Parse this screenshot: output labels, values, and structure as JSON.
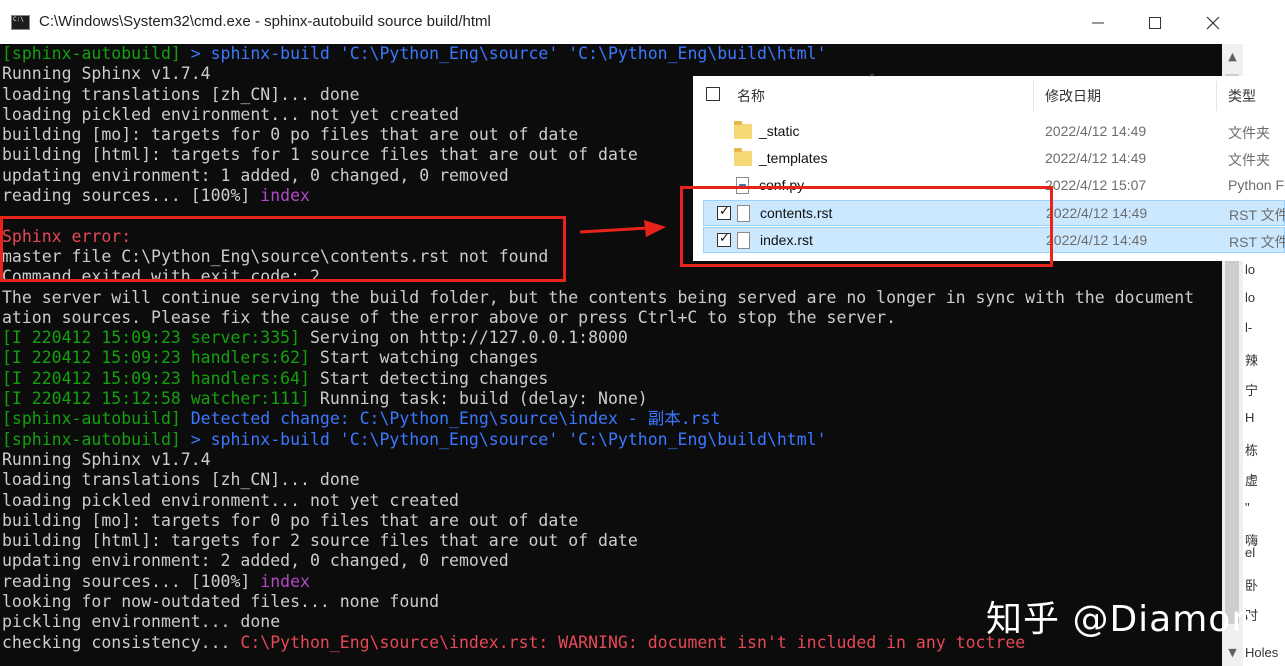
{
  "window": {
    "title": "C:\\Windows\\System32\\cmd.exe - sphinx-autobuild  source build/html",
    "icon": "cmd-icon"
  },
  "console": {
    "lines": [
      [
        {
          "t": "[sphinx-autobuild] ",
          "c": "green"
        },
        {
          "t": "> sphinx-build 'C:\\Python_Eng\\source' 'C:\\Python_Eng\\build\\html'",
          "c": "blue"
        }
      ],
      [
        {
          "t": "Running Sphinx v1.7.4",
          "c": "default"
        }
      ],
      [
        {
          "t": "loading translations [zh_CN]... done",
          "c": "default"
        }
      ],
      [
        {
          "t": "loading pickled environment... not yet created",
          "c": "default"
        }
      ],
      [
        {
          "t": "building [mo]: targets for 0 po files that are out of date",
          "c": "default"
        }
      ],
      [
        {
          "t": "building [html]: targets for 1 source files that are out of date",
          "c": "default"
        }
      ],
      [
        {
          "t": "updating environment: 1 added, 0 changed, 0 removed",
          "c": "default"
        }
      ],
      [
        {
          "t": "reading sources... [100%] ",
          "c": "default"
        },
        {
          "t": "index",
          "c": "purple"
        }
      ],
      [
        {
          "t": "",
          "c": "default"
        }
      ],
      [
        {
          "t": "Sphinx error:",
          "c": "red"
        }
      ],
      [
        {
          "t": "master file C:\\Python_Eng\\source\\contents.rst not found",
          "c": "default"
        }
      ],
      [
        {
          "t": "Command exited with exit code: 2",
          "c": "default"
        }
      ],
      [
        {
          "t": "The server will continue serving the build folder, but the contents being served are no longer in sync with the document",
          "c": "default"
        }
      ],
      [
        {
          "t": "ation sources. Please fix the cause of the error above or press Ctrl+C to stop the server.",
          "c": "default"
        }
      ],
      [
        {
          "t": "[I 220412 15:09:23 server:335] ",
          "c": "green"
        },
        {
          "t": "Serving on http://127.0.0.1:8000",
          "c": "default"
        }
      ],
      [
        {
          "t": "[I 220412 15:09:23 handlers:62] ",
          "c": "green"
        },
        {
          "t": "Start watching changes",
          "c": "default"
        }
      ],
      [
        {
          "t": "[I 220412 15:09:23 handlers:64] ",
          "c": "green"
        },
        {
          "t": "Start detecting changes",
          "c": "default"
        }
      ],
      [
        {
          "t": "[I 220412 15:12:58 watcher:111] ",
          "c": "green"
        },
        {
          "t": "Running task: build (delay: None)",
          "c": "default"
        }
      ],
      [
        {
          "t": "[sphinx-autobuild] ",
          "c": "green"
        },
        {
          "t": "Detected change: C:\\Python_Eng\\source\\index - 副本.rst",
          "c": "blue"
        }
      ],
      [
        {
          "t": "[sphinx-autobuild] ",
          "c": "green"
        },
        {
          "t": "> sphinx-build 'C:\\Python_Eng\\source' 'C:\\Python_Eng\\build\\html'",
          "c": "blue"
        }
      ],
      [
        {
          "t": "Running Sphinx v1.7.4",
          "c": "default"
        }
      ],
      [
        {
          "t": "loading translations [zh_CN]... done",
          "c": "default"
        }
      ],
      [
        {
          "t": "loading pickled environment... not yet created",
          "c": "default"
        }
      ],
      [
        {
          "t": "building [mo]: targets for 0 po files that are out of date",
          "c": "default"
        }
      ],
      [
        {
          "t": "building [html]: targets for 2 source files that are out of date",
          "c": "default"
        }
      ],
      [
        {
          "t": "updating environment: 2 added, 0 changed, 0 removed",
          "c": "default"
        }
      ],
      [
        {
          "t": "reading sources... [100%] ",
          "c": "default"
        },
        {
          "t": "index",
          "c": "purple"
        }
      ],
      [
        {
          "t": "looking for now-outdated files... none found",
          "c": "default"
        }
      ],
      [
        {
          "t": "pickling environment... ",
          "c": "default"
        },
        {
          "t": "done",
          "c": "default"
        }
      ],
      [
        {
          "t": "checking consistency... ",
          "c": "default"
        },
        {
          "t": "C:\\Python_Eng\\source\\index.rst: WARNING: document isn't included in any toctree",
          "c": "red"
        }
      ]
    ]
  },
  "explorer": {
    "headers": {
      "name": "名称",
      "date": "修改日期",
      "type": "类型"
    },
    "files": [
      {
        "name": "_static",
        "date": "2022/4/12 14:49",
        "type": "文件夹",
        "icon": "folder-icon",
        "selected": false
      },
      {
        "name": "_templates",
        "date": "2022/4/12 14:49",
        "type": "文件夹",
        "icon": "folder-icon",
        "selected": false
      },
      {
        "name": "conf.py",
        "date": "2022/4/12 15:07",
        "type": "Python File",
        "icon": "python-file-icon",
        "selected": false
      },
      {
        "name": "contents.rst",
        "date": "2022/4/12 14:49",
        "type": "RST 文件",
        "icon": "file-icon",
        "selected": true
      },
      {
        "name": "index.rst",
        "date": "2022/4/12 14:49",
        "type": "RST 文件",
        "icon": "file-icon",
        "selected": true
      }
    ]
  },
  "side_fragments": [
    "lo",
    "lo",
    "l-",
    "辣",
    "宁",
    "H",
    "栋",
    "虚",
    "\"",
    "嗨",
    "el",
    "卧",
    "时",
    "Holes"
  ],
  "watermark": "知乎 @Diamon",
  "colors": {
    "console_bg": "#0c0c0c",
    "green": "#13a10e",
    "blue": "#3b78ff",
    "purple": "#b148c6",
    "red": "#e74856",
    "annotation": "#e8231c",
    "selection": "#cce8ff"
  }
}
